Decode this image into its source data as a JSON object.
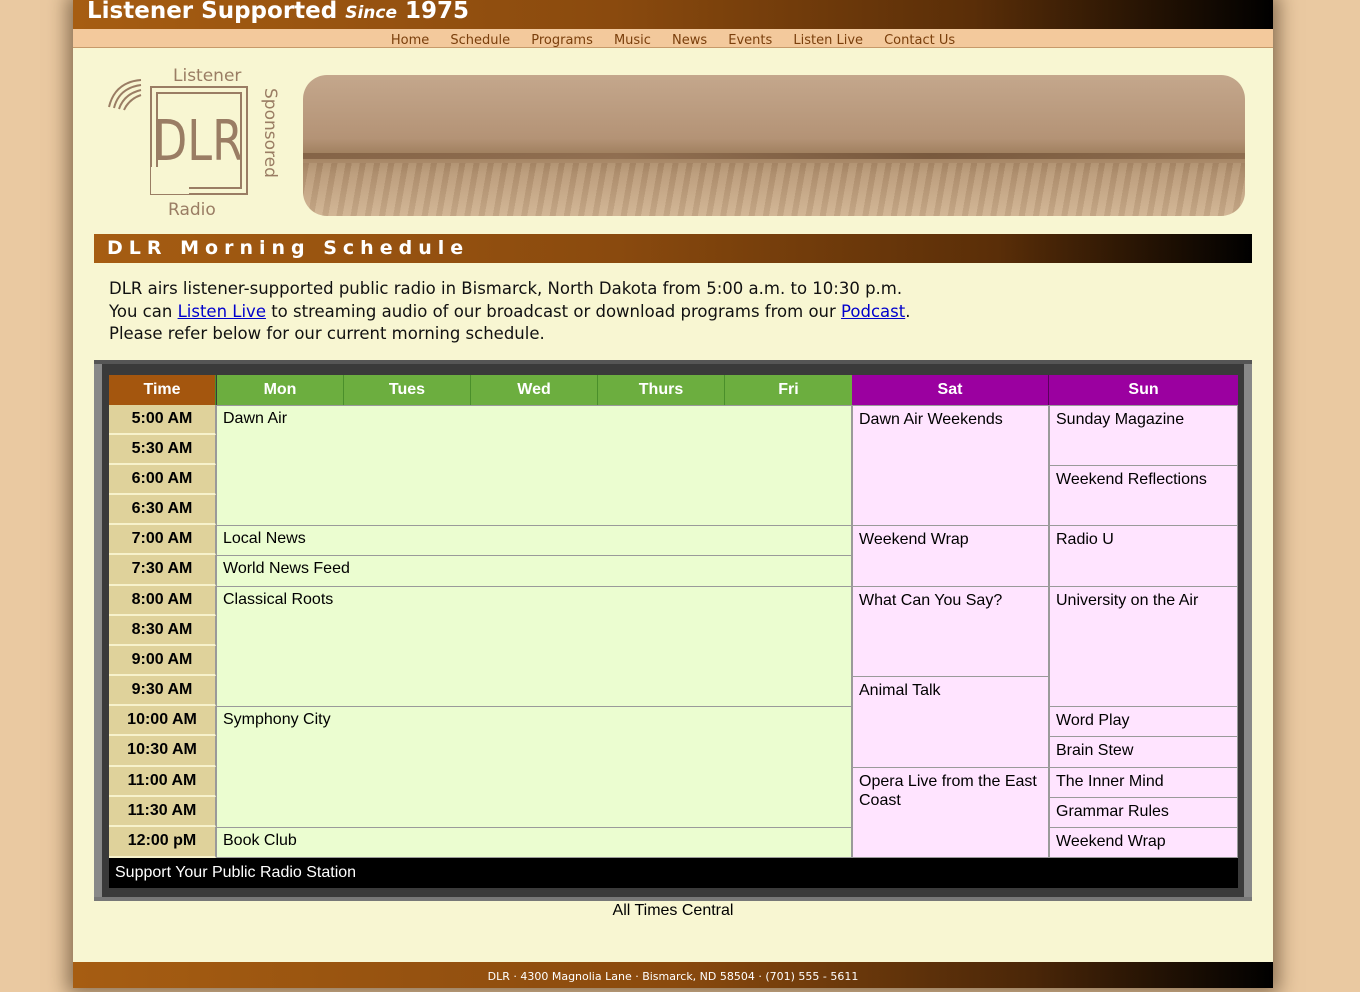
{
  "header": {
    "tagline_start": "Listener Supported",
    "tagline_since": "Since",
    "tagline_year": "1975"
  },
  "nav": [
    "Home",
    "Schedule",
    "Programs",
    "Music",
    "News",
    "Events",
    "Listen Live",
    "Contact Us"
  ],
  "logo": {
    "top": "Listener",
    "side": "Sponsored",
    "letters": "DLR",
    "bottom": "Radio"
  },
  "section_title": "DLR Morning Schedule",
  "intro": {
    "line1": "DLR airs listener-supported public radio in Bismarck, North Dakota from 5:00 a.m. to 10:30 p.m.",
    "line2_a": "You can ",
    "line2_link1": "Listen Live",
    "line2_b": " to streaming audio of our broadcast or download programs from our ",
    "line2_link2": "Podcast",
    "line2_c": ".",
    "line3": "Please refer below for our current morning schedule."
  },
  "schedule": {
    "headers": {
      "time": "Time",
      "mon": "Mon",
      "tues": "Tues",
      "wed": "Wed",
      "thurs": "Thurs",
      "fri": "Fri",
      "sat": "Sat",
      "sun": "Sun"
    },
    "times": [
      "5:00 AM",
      "5:30 AM",
      "6:00 AM",
      "6:30 AM",
      "7:00 AM",
      "7:30 AM",
      "8:00 AM",
      "8:30 AM",
      "9:00 AM",
      "9:30 AM",
      "10:00 AM",
      "10:30 AM",
      "11:00 AM",
      "11:30 AM",
      "12:00 pM"
    ],
    "weekday": [
      "Dawn Air",
      "Local News",
      "World News Feed",
      "Classical Roots",
      "Symphony City",
      "Book Club"
    ],
    "saturday": [
      "Dawn Air Weekends",
      "Weekend Wrap",
      "What Can You Say?",
      "Animal Talk",
      "Opera Live from the East Coast"
    ],
    "sunday": [
      "Sunday Magazine",
      "Weekend Reflections",
      "Radio U",
      "University on the Air",
      "Word Play",
      "Brain Stew",
      "The Inner Mind",
      "Grammar Rules",
      "Weekend Wrap"
    ],
    "footer": "Support Your Public Radio Station"
  },
  "times_note": "All Times Central",
  "footer": "DLR · 4300 Magnolia Lane · Bismarck, ND 58504 · (701) 555 - 5611",
  "colors": {
    "brand_brown": "#a65d12",
    "weekday_green": "#6cae3f",
    "weekend_purple": "#9b00a0",
    "page_bg": "#f8f6d2"
  }
}
